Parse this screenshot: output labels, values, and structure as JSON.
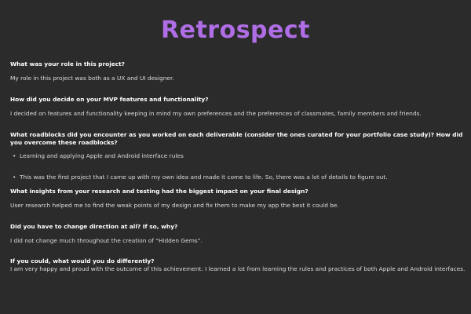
{
  "page": {
    "title": "Retrospect"
  },
  "qa": [
    {
      "question": "What was your role in this project?",
      "answer": "My role in this project was both as a UX and UI designer."
    },
    {
      "question": "How did you decide on your MVP features and functionality?",
      "answer": "I decided on features and functionality keeping in mind my own preferences and the preferences of classmates, family members and friends."
    },
    {
      "question": "What roadblocks did you encounter as you worked on each deliverable (consider the ones curated for your portfolio case study)? How did you overcome these roadblocks?",
      "bullets": [
        "Learning and applying Apple and Android interface rules",
        "This was the first project that I came up with my own idea and made it come to life. So, there was a lot of details to figure out."
      ]
    },
    {
      "question": "What insights from your research and testing had the biggest impact on your final design?",
      "answer": "User research helped me to find the weak points of my design and fix them to make my app the best it could be."
    },
    {
      "question": "Did you have to change direction at all? If so, why?",
      "answer": "I did not change much throughout the creation of “Hidden Gems”."
    },
    {
      "question": "If you could, what would you do differently?",
      "answer": "I am very happy and proud with the outcome of this achievement. I learned a lot from learning the rules and practices of both Apple and Android interfaces."
    }
  ],
  "bullet_glyph": "•"
}
